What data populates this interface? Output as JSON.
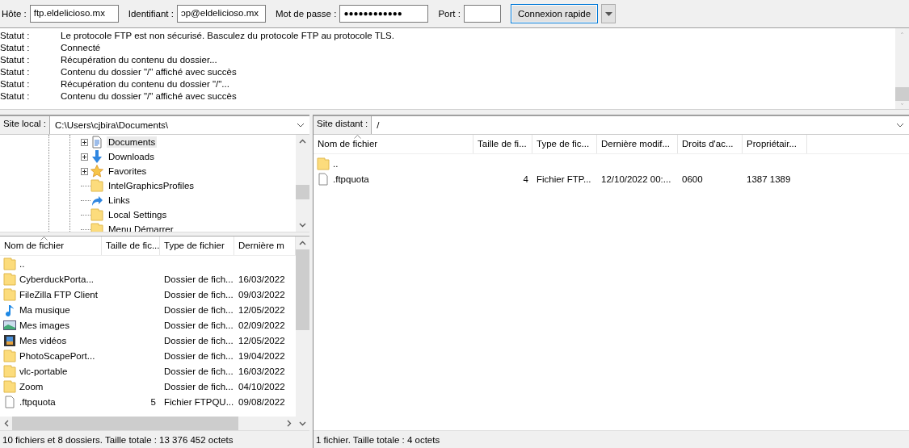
{
  "quickconnect": {
    "fields": [
      {
        "label": "Hôte :",
        "value": "ftp.eldelicioso.mx",
        "kind": "text"
      },
      {
        "label": "Identifiant :",
        "value": "ɔp@eldelicioso.mx",
        "kind": "text"
      },
      {
        "label": "Mot de passe :",
        "value": "●●●●●●●●●●●●",
        "kind": "password"
      },
      {
        "label": "Port :",
        "kind": "text"
      }
    ],
    "button": "Connexion rapide"
  },
  "log": [
    {
      "label": "Statut :",
      "message": "Le protocole FTP est non sécurisé. Basculez du protocole FTP au protocole TLS."
    },
    {
      "label": "Statut :",
      "message": "Connecté"
    },
    {
      "label": "Statut :",
      "message": "Récupération du contenu du dossier..."
    },
    {
      "label": "Statut :",
      "message": "Contenu du dossier \"/\" affiché avec succès"
    },
    {
      "label": "Statut :",
      "message": "Récupération du contenu du dossier \"/\"..."
    },
    {
      "label": "Statut :",
      "message": "Contenu du dossier \"/\" affiché avec succès"
    }
  ],
  "local": {
    "site_label": "Site local :",
    "path": "C:\\Users\\cjbira\\Documents\\",
    "tree": [
      {
        "name": "Documents",
        "kind": "document",
        "expandable": true,
        "selected": true
      },
      {
        "name": "Downloads",
        "kind": "download",
        "expandable": true,
        "selected": false
      },
      {
        "name": "Favorites",
        "kind": "star",
        "expandable": true,
        "selected": false
      },
      {
        "name": "IntelGraphicsProfiles",
        "kind": "folder",
        "expandable": false,
        "selected": false
      },
      {
        "name": "Links",
        "kind": "link",
        "expandable": false,
        "selected": false
      },
      {
        "name": "Local Settings",
        "kind": "folder",
        "expandable": false,
        "selected": false
      },
      {
        "name": "Menu Démarrer",
        "kind": "folder",
        "expandable": false,
        "selected": false
      }
    ],
    "columns": [
      {
        "label": "Nom de fichier",
        "sorted": true
      },
      {
        "label": "Taille de fic...",
        "sorted": false
      },
      {
        "label": "Type de fichier",
        "sorted": false
      },
      {
        "label": "Dernière m",
        "sorted": false
      }
    ],
    "rows": [
      {
        "kind": "folder",
        "name": ".."
      },
      {
        "kind": "folder",
        "name": "CyberduckPorta...",
        "type": "Dossier de fich...",
        "modified": "16/03/2022"
      },
      {
        "kind": "folder",
        "name": "FileZilla FTP Client",
        "type": "Dossier de fich...",
        "modified": "09/03/2022"
      },
      {
        "kind": "music",
        "name": "Ma musique",
        "type": "Dossier de fich...",
        "modified": "12/05/2022"
      },
      {
        "kind": "image",
        "name": "Mes images",
        "type": "Dossier de fich...",
        "modified": "02/09/2022"
      },
      {
        "kind": "video",
        "name": "Mes vidéos",
        "type": "Dossier de fich...",
        "modified": "12/05/2022"
      },
      {
        "kind": "folder",
        "name": "PhotoScapePort...",
        "type": "Dossier de fich...",
        "modified": "19/04/2022"
      },
      {
        "kind": "folder",
        "name": "vlc-portable",
        "type": "Dossier de fich...",
        "modified": "16/03/2022"
      },
      {
        "kind": "folder",
        "name": "Zoom",
        "type": "Dossier de fich...",
        "modified": "04/10/2022"
      },
      {
        "kind": "file",
        "name": ".ftpquota",
        "size": "5",
        "type": "Fichier FTPQU...",
        "modified": "09/08/2022"
      }
    ],
    "status": "10 fichiers et 8 dossiers. Taille totale : 13 376 452 octets"
  },
  "remote": {
    "site_label": "Site distant :",
    "path": "/",
    "columns": [
      {
        "label": "Nom de fichier",
        "sorted": true
      },
      {
        "label": "Taille de fi...",
        "sorted": false
      },
      {
        "label": "Type de fic...",
        "sorted": false
      },
      {
        "label": "Dernière modif...",
        "sorted": false
      },
      {
        "label": "Droits d'ac...",
        "sorted": false
      },
      {
        "label": "Propriétair...",
        "sorted": false
      }
    ],
    "rows": [
      {
        "kind": "folder",
        "cells": [
          ".."
        ]
      },
      {
        "kind": "file",
        "cells": [
          ".ftpquota",
          "4",
          "Fichier FTP...",
          "12/10/2022 00:...",
          "0600",
          "1387 1389"
        ]
      }
    ],
    "status": "1 fichier. Taille totale : 4 octets"
  }
}
